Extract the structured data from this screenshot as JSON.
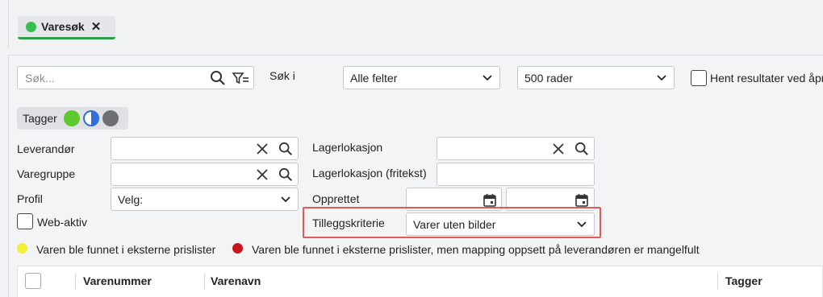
{
  "tab": {
    "label": "Varesøk",
    "status_color": "#33c04f"
  },
  "search": {
    "placeholder": "Søk...",
    "search_in_label": "Søk i",
    "field_value": "Alle felter",
    "rows_value": "500 rader",
    "fetch_label": "Hent resultater ved åpn"
  },
  "tags": {
    "label": "Tagger",
    "filters": [
      "green",
      "half-blue",
      "gray"
    ]
  },
  "filters": {
    "supplier_label": "Leverandør",
    "product_group_label": "Varegruppe",
    "profile_label": "Profil",
    "profile_value": "Velg:",
    "web_active_label": "Web-aktiv",
    "warehouse_label": "Lagerlokasjon",
    "warehouse_free_label": "Lagerlokasjon (fritekst)",
    "created_label": "Opprettet",
    "extra_criteria_label": "Tilleggskriterie",
    "extra_criteria_value": "Varer uten bilder"
  },
  "legend": {
    "found_label": "Varen ble funnet i eksterne prislister",
    "found_color": "#f2ee3a",
    "mapping_label": "Varen ble funnet i eksterne prislister, men mapping oppsett på leverandøren er mangelfult",
    "mapping_color": "#c8161d"
  },
  "table": {
    "columns": [
      "Varenummer",
      "Varenavn",
      "Tagger"
    ]
  },
  "colors": {
    "accent": "#2e9d4a",
    "highlight": "#e05a5a"
  }
}
